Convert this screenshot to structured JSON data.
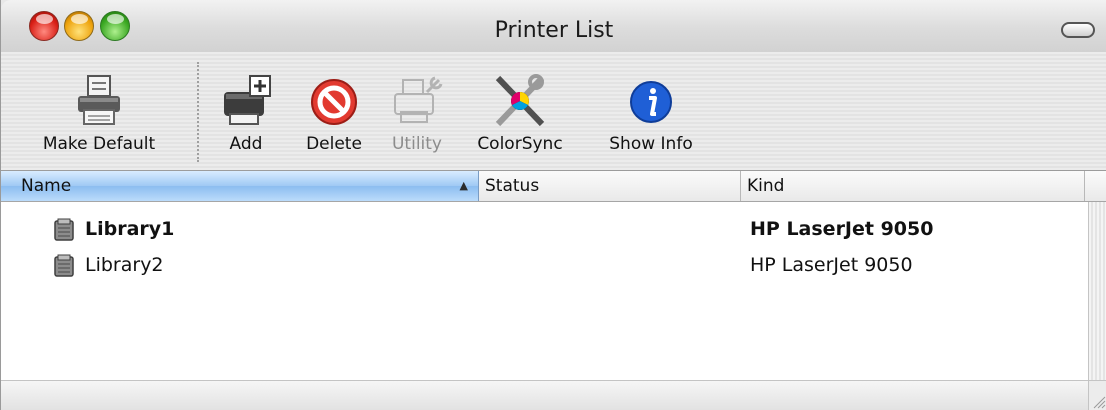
{
  "window": {
    "title": "Printer List"
  },
  "toolbar": {
    "items": [
      {
        "label": "Make Default",
        "icon": "printer-icon",
        "enabled": true
      },
      {
        "label": "Add",
        "icon": "add-printer-icon",
        "enabled": true
      },
      {
        "label": "Delete",
        "icon": "delete-icon",
        "enabled": true
      },
      {
        "label": "Utility",
        "icon": "printer-utility-icon",
        "enabled": false
      },
      {
        "label": "ColorSync",
        "icon": "colorsync-icon",
        "enabled": true
      },
      {
        "label": "Show Info",
        "icon": "info-icon",
        "enabled": true
      }
    ]
  },
  "table": {
    "columns": [
      "Name",
      "Status",
      "Kind"
    ],
    "sort_indicator": "▲",
    "rows": [
      {
        "name": "Library1",
        "status": "",
        "kind": "HP LaserJet 9050",
        "default": true,
        "icon": "printer-library-icon"
      },
      {
        "name": "Library2",
        "status": "",
        "kind": "HP LaserJet 9050",
        "default": false,
        "icon": "printer-library-icon"
      }
    ]
  },
  "colors": {
    "selected_column_header": "#9fc9f4",
    "close_button": "#d81e15",
    "minimize_button": "#eda10a",
    "zoom_button": "#3aa722",
    "info_icon": "#1f5fd6"
  }
}
